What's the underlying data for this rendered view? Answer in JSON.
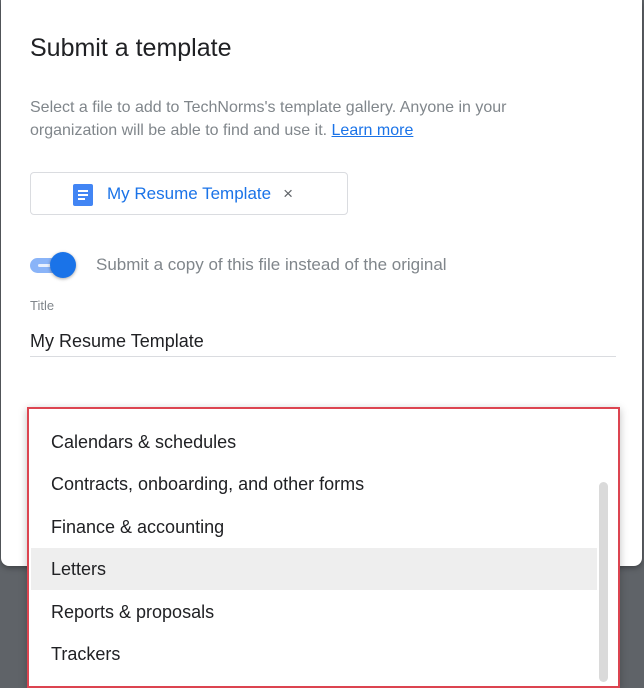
{
  "dialog": {
    "title": "Submit a template",
    "description": "Select a file to add to TechNorms's template gallery. Anyone in your organization will be able to find and use it.",
    "learn_more": "Learn more"
  },
  "file_chip": {
    "label": "My Resume Template",
    "icon": "google-docs-icon",
    "close_glyph": "×"
  },
  "copy_toggle": {
    "checked": true,
    "label": "Submit a copy of this file instead of the original"
  },
  "title_field": {
    "label": "Title",
    "value": "My Resume Template"
  },
  "category_dropdown": {
    "options": [
      "Calendars & schedules",
      "Contracts, onboarding, and other forms",
      "Finance & accounting",
      "Letters",
      "Reports & proposals",
      "Trackers"
    ],
    "highlighted": "Letters"
  },
  "colors": {
    "accent": "#1a73e8",
    "highlight_border": "#dc4450"
  }
}
